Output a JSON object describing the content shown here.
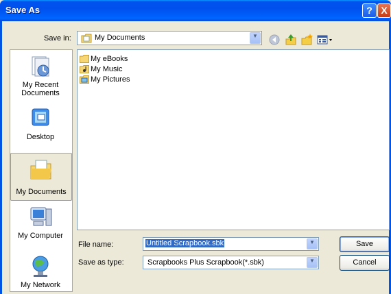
{
  "window": {
    "title": "Save As",
    "help_glyph": "?",
    "close_glyph": "X"
  },
  "toolbar": {
    "save_in_label": "Save in:",
    "save_in_value": "My Documents",
    "icons": [
      "back-icon",
      "up-folder-icon",
      "new-folder-icon",
      "views-menu-icon"
    ]
  },
  "places": [
    {
      "label_line1": "My Recent",
      "label_line2": "Documents",
      "icon": "recent-documents-icon"
    },
    {
      "label_line1": "Desktop",
      "label_line2": "",
      "icon": "desktop-icon"
    },
    {
      "label_line1": "My Documents",
      "label_line2": "",
      "icon": "my-documents-icon",
      "selected": true
    },
    {
      "label_line1": "My Computer",
      "label_line2": "",
      "icon": "my-computer-icon"
    },
    {
      "label_line1": "My Network",
      "label_line2": "",
      "icon": "my-network-icon"
    }
  ],
  "files": [
    {
      "name": "My eBooks",
      "icon": "folder-icon"
    },
    {
      "name": "My Music",
      "icon": "music-folder-icon"
    },
    {
      "name": "My Pictures",
      "icon": "pictures-folder-icon"
    }
  ],
  "form": {
    "file_name_label": "File name:",
    "file_name_value": "Untitled Scrapbook.sbk",
    "save_type_label": "Save as type:",
    "save_type_value": "Scrapbooks Plus Scrapbook(*.sbk)"
  },
  "buttons": {
    "save": "Save",
    "cancel": "Cancel"
  },
  "colors": {
    "title_bar": "#0053EE",
    "dialog_bg": "#ECE9D8",
    "selection": "#316AC5"
  }
}
